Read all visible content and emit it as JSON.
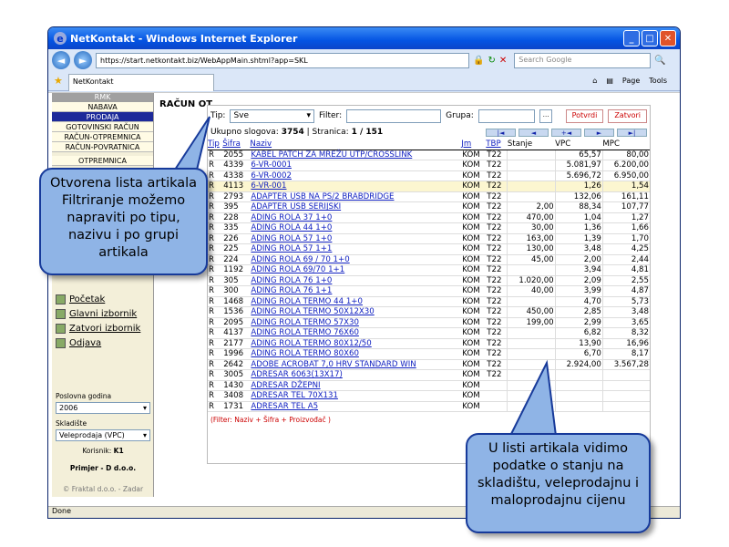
{
  "window": {
    "title": "NetKontakt - Windows Internet Explorer"
  },
  "browser": {
    "url": "https://start.netkontakt.biz/WebAppMain.shtml?app=SKL",
    "search_placeholder": "Search Google",
    "tab_label": "NetKontakt",
    "page_menu": "Page",
    "tools_menu": "Tools",
    "status": "Done"
  },
  "sidebar": {
    "header": "RMK",
    "items": [
      "NABAVA",
      "PRODAJA",
      "GOTOVINSKI RAČUN",
      "RAČUN-OTPREMNICA",
      "RAČUN-POVRATNICA",
      "OTPREMNICA"
    ],
    "links": [
      "Početak",
      "Glavni izbornik",
      "Zatvori izbornik",
      "Odjava"
    ],
    "year_label": "Poslovna godina",
    "year_value": "2006",
    "warehouse_label": "Skladište",
    "warehouse_value": "Veleprodaja (VPC)",
    "user_label": "Korisnik:",
    "user_value": "K1",
    "company": "Primjer - D d.o.o.",
    "footer": "© Fraktal d.o.o. - Zadar"
  },
  "main": {
    "title": "RAČUN OT",
    "tip_label": "Tip:",
    "tip_value": "Sve",
    "filter_label": "Filter:",
    "grupa_label": "Grupa:",
    "confirm_btn": "Potvrdi",
    "close_btn": "Zatvori",
    "total_label": "Ukupno slogova:",
    "total_value": "3754",
    "page_label": "Stranica:",
    "page_value": "1 / 151",
    "pager": [
      "|◄",
      "◄",
      "+◄",
      "►",
      "►|"
    ],
    "columns": [
      "Tip",
      "Šifra",
      "Naziv",
      "Jm",
      "TBP",
      "Stanje",
      "VPC",
      "MPC"
    ],
    "rows": [
      [
        "R",
        "2055",
        "KABEL PATCH ZA MREŽU UTP/CROSSLINK",
        "KOM",
        "T22",
        "",
        "65,57",
        "80,00"
      ],
      [
        "R",
        "4339",
        "6-VR-0001",
        "KOM",
        "T22",
        "",
        "5.081,97",
        "6.200,00"
      ],
      [
        "R",
        "4338",
        "6-VR-0002",
        "KOM",
        "T22",
        "",
        "5.696,72",
        "6.950,00"
      ],
      [
        "R",
        "4113",
        "6-VR-001",
        "KOM",
        "T22",
        "",
        "1,26",
        "1,54"
      ],
      [
        "R",
        "2793",
        "ADAPTER USB NA PS/2 BRABDRIDGE",
        "KOM",
        "T22",
        "",
        "132,06",
        "161,11"
      ],
      [
        "R",
        "395",
        "ADAPTER USB SERIJSKI",
        "KOM",
        "T22",
        "2,00",
        "88,34",
        "107,77"
      ],
      [
        "R",
        "228",
        "ADING ROLA 37 1+0",
        "KOM",
        "T22",
        "470,00",
        "1,04",
        "1,27"
      ],
      [
        "R",
        "335",
        "ADING ROLA 44 1+0",
        "KOM",
        "T22",
        "30,00",
        "1,36",
        "1,66"
      ],
      [
        "R",
        "226",
        "ADING ROLA 57 1+0",
        "KOM",
        "T22",
        "163,00",
        "1,39",
        "1,70"
      ],
      [
        "R",
        "225",
        "ADING ROLA 57 1+1",
        "KOM",
        "T22",
        "130,00",
        "3,48",
        "4,25"
      ],
      [
        "R",
        "224",
        "ADING ROLA 69 / 70 1+0",
        "KOM",
        "T22",
        "45,00",
        "2,00",
        "2,44"
      ],
      [
        "R",
        "1192",
        "ADING ROLA 69/70 1+1",
        "KOM",
        "T22",
        "",
        "3,94",
        "4,81"
      ],
      [
        "R",
        "305",
        "ADING ROLA 76 1+0",
        "KOM",
        "T22",
        "1.020,00",
        "2,09",
        "2,55"
      ],
      [
        "R",
        "300",
        "ADING ROLA 76 1+1",
        "KOM",
        "T22",
        "40,00",
        "3,99",
        "4,87"
      ],
      [
        "R",
        "1468",
        "ADING ROLA TERMO 44 1+0",
        "KOM",
        "T22",
        "",
        "4,70",
        "5,73"
      ],
      [
        "R",
        "1536",
        "ADING ROLA TERMO 50X12X30",
        "KOM",
        "T22",
        "450,00",
        "2,85",
        "3,48"
      ],
      [
        "R",
        "2095",
        "ADING ROLA TERMO 57X30",
        "KOM",
        "T22",
        "199,00",
        "2,99",
        "3,65"
      ],
      [
        "R",
        "4137",
        "ADING ROLA TERMO 76X60",
        "KOM",
        "T22",
        "",
        "6,82",
        "8,32"
      ],
      [
        "R",
        "2177",
        "ADING ROLA TERMO 80X12/50",
        "KOM",
        "T22",
        "",
        "13,90",
        "16,96"
      ],
      [
        "R",
        "1996",
        "ADING ROLA TERMO 80X60",
        "KOM",
        "T22",
        "",
        "6,70",
        "8,17"
      ],
      [
        "R",
        "2642",
        "ADOBE ACROBAT 7,0 HRV STANDARD WIN",
        "KOM",
        "T22",
        "",
        "2.924,00",
        "3.567,28"
      ],
      [
        "R",
        "3005",
        "ADRESAR 6063(13X17)",
        "KOM",
        "T22",
        "",
        "",
        ""
      ],
      [
        "R",
        "1430",
        "ADRESAR DŽEPNI",
        "KOM",
        "",
        "",
        "",
        ""
      ],
      [
        "R",
        "3408",
        "ADRESAR TEL 70X131",
        "KOM",
        "",
        "",
        "",
        ""
      ],
      [
        "R",
        "1731",
        "ADRESAR TEL A5",
        "KOM",
        "",
        "",
        "",
        ""
      ]
    ],
    "footnote": "(Filter: Naziv + Šifra + Proizvođač )"
  },
  "callouts": {
    "left": "Otvorena lista artikala Filtriranje možemo napraviti po tipu, nazivu i po grupi artikala",
    "right": "U listi artikala vidimo podatke o stanju na skladištu, veleprodajnu i maloprodajnu cijenu"
  }
}
